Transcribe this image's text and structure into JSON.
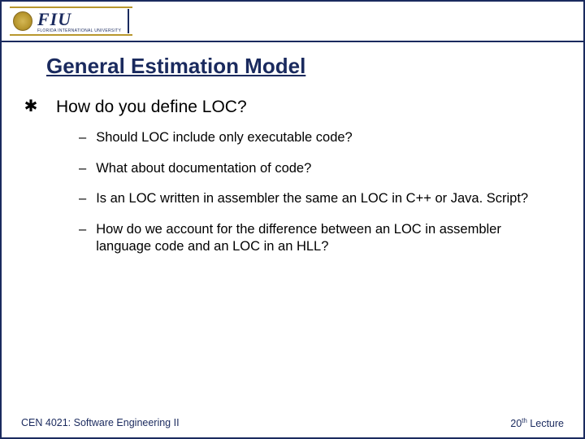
{
  "header": {
    "logo_text": "FIU",
    "logo_sub": "FLORIDA INTERNATIONAL UNIVERSITY"
  },
  "title": "General Estimation Model",
  "main_question": "How do you define LOC?",
  "sub_items": [
    "Should LOC include only executable code?",
    "What about documentation of code?",
    "Is an LOC written in assembler the same an LOC in C++ or Java. Script?",
    "How do we account for the difference between an LOC in assembler language code and an LOC in an HLL?"
  ],
  "footer": {
    "left": "CEN 4021: Software Engineering II",
    "right_num": "20",
    "right_suffix": "th",
    "right_word": " Lecture"
  }
}
